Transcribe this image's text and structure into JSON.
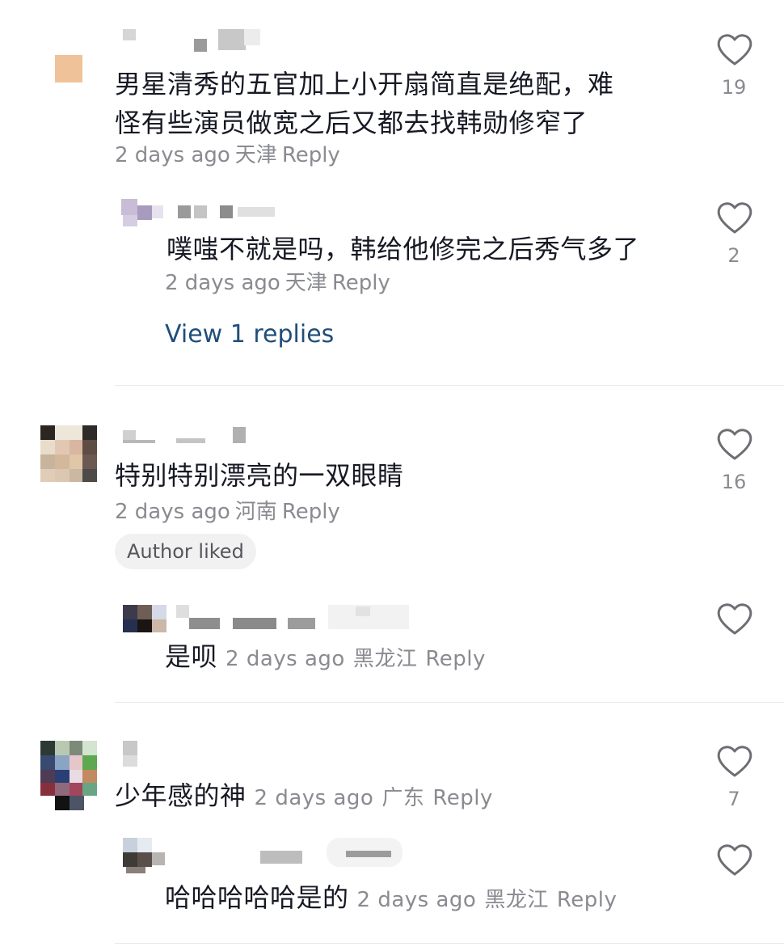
{
  "comments": [
    {
      "text_line1": "男星清秀的五官加上小开扇简直是绝配，难",
      "text_line2": "怪有些演员做宽之后又都去找韩勋修窄了",
      "time": "2 days ago",
      "location": "天津",
      "reply_label": "Reply",
      "likes": "19",
      "replies": [
        {
          "text": "噗嗤不就是吗，韩给他修完之后秀气多了",
          "time": "2 days ago",
          "location": "天津",
          "reply_label": "Reply",
          "likes": "2"
        }
      ],
      "view_replies": "View 1 replies"
    },
    {
      "text": "特别特别漂亮的一双眼睛",
      "time": "2 days ago",
      "location": "河南",
      "reply_label": "Reply",
      "likes": "16",
      "badge": "Author liked",
      "replies": [
        {
          "text": "是呗",
          "time": "2 days ago",
          "location": "黑龙江",
          "reply_label": "Reply",
          "likes": ""
        }
      ]
    },
    {
      "text": "少年感的神",
      "time": "2 days ago",
      "location": "广东",
      "reply_label": "Reply",
      "likes": "7",
      "replies": [
        {
          "text": "哈哈哈哈哈是的",
          "time": "2 days ago",
          "location": "黑龙江",
          "reply_label": "Reply",
          "likes": ""
        }
      ]
    }
  ],
  "icons": {
    "like": "heart-outline-icon"
  },
  "colors": {
    "link": "#1f4e79",
    "meta": "#8a8b91",
    "text": "#161823"
  }
}
